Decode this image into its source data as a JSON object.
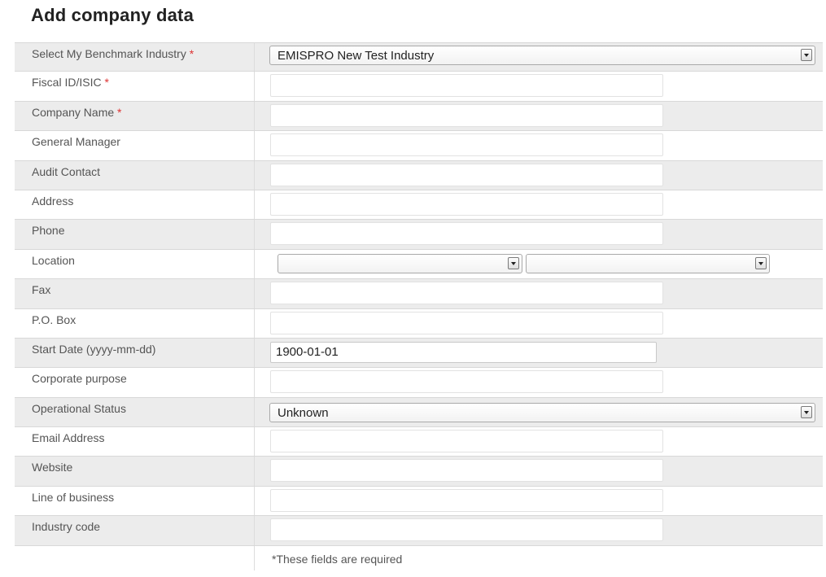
{
  "page": {
    "title": "Add company data"
  },
  "form": {
    "benchmark_industry": {
      "label": "Select My Benchmark Industry",
      "required_mark": "*",
      "value": "EMISPRO New Test Industry"
    },
    "fiscal_id": {
      "label": "Fiscal ID/ISIC",
      "required_mark": "*",
      "value": ""
    },
    "company_name": {
      "label": "Company Name",
      "required_mark": "*",
      "value": ""
    },
    "general_manager": {
      "label": "General Manager",
      "value": ""
    },
    "audit_contact": {
      "label": "Audit Contact",
      "value": ""
    },
    "address": {
      "label": "Address",
      "value": ""
    },
    "phone": {
      "label": "Phone",
      "value": ""
    },
    "location": {
      "label": "Location",
      "value_1": "",
      "value_2": ""
    },
    "fax": {
      "label": "Fax",
      "value": ""
    },
    "po_box": {
      "label": "P.O. Box",
      "value": ""
    },
    "start_date": {
      "label": "Start Date (yyyy-mm-dd)",
      "value": "1900-01-01"
    },
    "corporate_purpose": {
      "label": "Corporate purpose",
      "value": ""
    },
    "operational_status": {
      "label": "Operational Status",
      "value": "Unknown"
    },
    "email_address": {
      "label": "Email Address",
      "value": ""
    },
    "website": {
      "label": "Website",
      "value": ""
    },
    "line_of_business": {
      "label": "Line of business",
      "value": ""
    },
    "industry_code": {
      "label": "Industry code",
      "value": ""
    },
    "required_note": "*These fields are required"
  },
  "icons": {
    "dropdown": "chevron-down-icon"
  },
  "colors": {
    "required": "#dd3333",
    "row_shade": "#ececec"
  }
}
